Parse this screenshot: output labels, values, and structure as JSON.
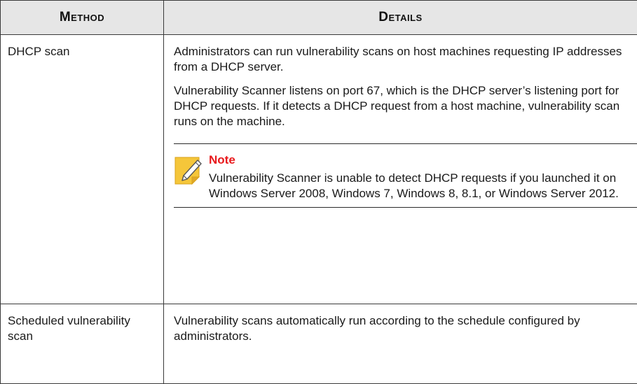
{
  "table": {
    "headers": {
      "method": "Method",
      "details": "Details"
    },
    "rows": [
      {
        "method": "DHCP scan",
        "paragraphs": [
          "Administrators can run vulnerability scans on host machines requesting IP addresses from a DHCP server.",
          "Vulnerability Scanner listens on port 67, which is the DHCP server’s listening port for DHCP requests. If it detects a DHCP request from a host machine, vulnerability scan runs on the machine."
        ],
        "note": {
          "icon": "note-pencil-icon",
          "title": "Note",
          "text": "Vulnerability Scanner is unable to detect DHCP requests if you launched it on Windows Server 2008, Windows 7, Windows 8, 8.1, or Windows Server 2012."
        }
      },
      {
        "method": "Scheduled vulnerability scan",
        "paragraphs": [
          "Vulnerability scans automatically run according to the schedule configured by administrators."
        ]
      }
    ]
  },
  "colors": {
    "header_bg": "#e6e6e6",
    "border": "#3a3a3a",
    "note_title": "#e8191c",
    "note_icon_fill": "#f5c63a"
  }
}
